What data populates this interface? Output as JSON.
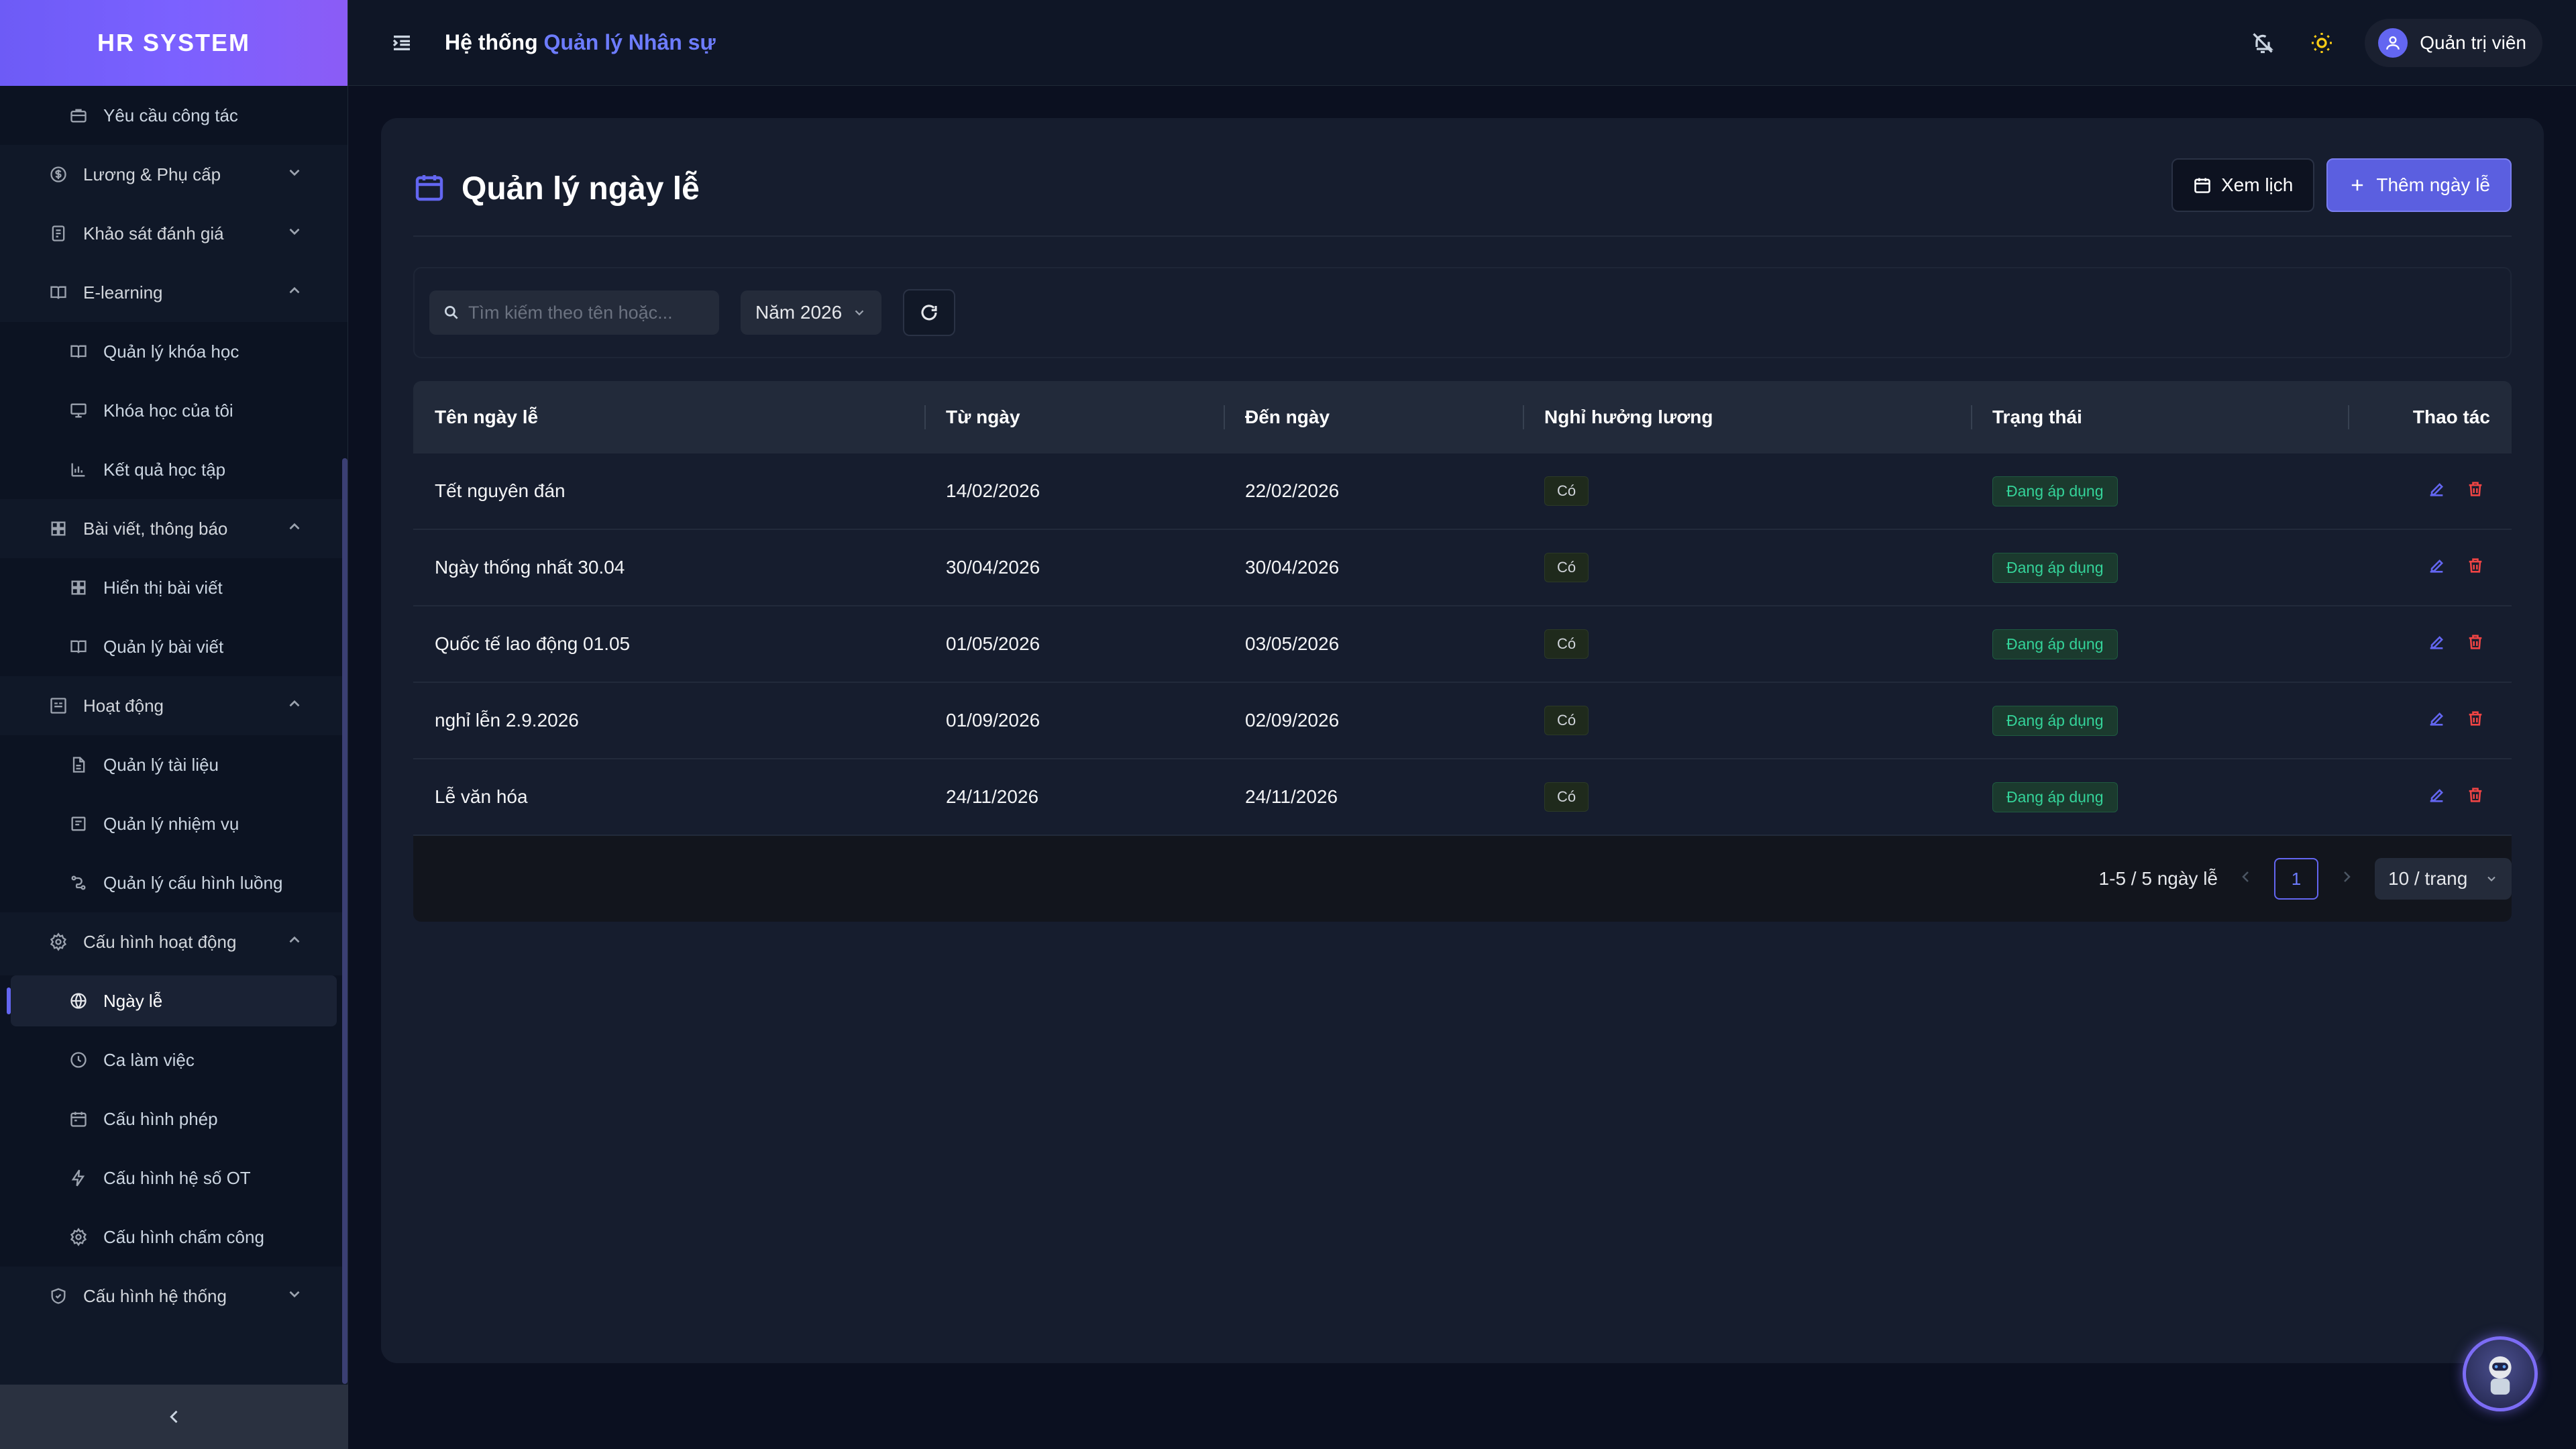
{
  "brand": "HR SYSTEM",
  "header": {
    "title_prefix": "Hệ thống",
    "title_accent": "Quản lý Nhân sự",
    "user_name": "Quản trị viên"
  },
  "sidebar": {
    "items": [
      {
        "type": "sub",
        "label": "Yêu cầu công tác",
        "icon": "briefcase-icon"
      },
      {
        "type": "group",
        "label": "Lương & Phụ cấp",
        "icon": "dollar-icon",
        "expanded": false
      },
      {
        "type": "group",
        "label": "Khảo sát đánh giá",
        "icon": "survey-icon",
        "expanded": false
      },
      {
        "type": "group",
        "label": "E-learning",
        "icon": "book-icon",
        "expanded": true
      },
      {
        "type": "sub",
        "label": "Quản lý khóa học",
        "icon": "book-open-icon"
      },
      {
        "type": "sub",
        "label": "Khóa học của tôi",
        "icon": "monitor-icon"
      },
      {
        "type": "sub",
        "label": "Kết quả học tập",
        "icon": "bar-chart-icon"
      },
      {
        "type": "group",
        "label": "Bài viết, thông báo",
        "icon": "grid-icon",
        "expanded": true
      },
      {
        "type": "sub",
        "label": "Hiển thị bài viết",
        "icon": "grid-icon"
      },
      {
        "type": "sub",
        "label": "Quản lý bài viết",
        "icon": "book-open-icon"
      },
      {
        "type": "group",
        "label": "Hoạt động",
        "icon": "activity-icon",
        "expanded": true
      },
      {
        "type": "sub",
        "label": "Quản lý tài liệu",
        "icon": "file-icon"
      },
      {
        "type": "sub",
        "label": "Quản lý nhiệm vụ",
        "icon": "task-icon"
      },
      {
        "type": "sub",
        "label": "Quản lý cấu hình luồng",
        "icon": "flow-icon"
      },
      {
        "type": "group",
        "label": "Cấu hình hoạt động",
        "icon": "gear-icon",
        "expanded": true
      },
      {
        "type": "sub",
        "label": "Ngày lễ",
        "icon": "globe-icon",
        "active": true
      },
      {
        "type": "sub",
        "label": "Ca làm việc",
        "icon": "clock-icon"
      },
      {
        "type": "sub",
        "label": "Cấu hình phép",
        "icon": "calendar-icon"
      },
      {
        "type": "sub",
        "label": "Cấu hình hệ số OT",
        "icon": "bolt-icon"
      },
      {
        "type": "sub",
        "label": "Cấu hình chấm công",
        "icon": "gear-icon"
      },
      {
        "type": "group",
        "label": "Cấu hình hệ thống",
        "icon": "shield-icon",
        "expanded": false
      }
    ]
  },
  "page": {
    "title": "Quản lý ngày lễ",
    "view_calendar_label": "Xem lịch",
    "add_label": "Thêm ngày lễ",
    "search_placeholder": "Tìm kiếm theo tên hoặc...",
    "year_filter": "Năm 2026"
  },
  "table": {
    "columns": [
      "Tên ngày lễ",
      "Từ ngày",
      "Đến ngày",
      "Nghỉ hưởng lương",
      "Trạng thái",
      "Thao tác"
    ],
    "rows": [
      {
        "name": "Tết nguyên đán",
        "from": "14/02/2026",
        "to": "22/02/2026",
        "paid": "Có",
        "status": "Đang áp dụng"
      },
      {
        "name": "Ngày thống nhất 30.04",
        "from": "30/04/2026",
        "to": "30/04/2026",
        "paid": "Có",
        "status": "Đang áp dụng"
      },
      {
        "name": "Quốc tế lao động 01.05",
        "from": "01/05/2026",
        "to": "03/05/2026",
        "paid": "Có",
        "status": "Đang áp dụng"
      },
      {
        "name": "nghỉ lễn 2.9.2026",
        "from": "01/09/2026",
        "to": "02/09/2026",
        "paid": "Có",
        "status": "Đang áp dụng"
      },
      {
        "name": "Lễ văn hóa",
        "from": "24/11/2026",
        "to": "24/11/2026",
        "paid": "Có",
        "status": "Đang áp dụng"
      }
    ]
  },
  "pagination": {
    "summary": "1-5 / 5 ngày lễ",
    "current_page": "1",
    "page_size": "10 / trang"
  },
  "colors": {
    "accent": "#6366f1",
    "status_active": "#34d399",
    "delete": "#ef4444"
  }
}
